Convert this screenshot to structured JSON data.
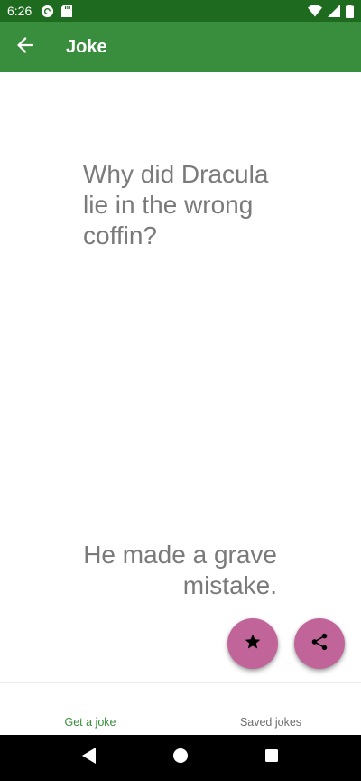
{
  "status_bar": {
    "time": "6:26",
    "left_icons": [
      "pocket-casts-icon",
      "sd-card-icon"
    ],
    "right_icons": [
      "wifi-icon",
      "signal-icon",
      "battery-icon"
    ]
  },
  "app_bar": {
    "title": "Joke",
    "back_icon": "arrow-back-icon"
  },
  "joke": {
    "setup": "Why did Dracula lie in the wrong coffin?",
    "punchline": "He made a grave mistake."
  },
  "fabs": [
    {
      "icon": "star-icon"
    },
    {
      "icon": "share-icon"
    }
  ],
  "tabs": [
    {
      "label": "Get a joke",
      "active": true
    },
    {
      "label": "Saved jokes",
      "active": false
    }
  ],
  "nav_bar": {
    "icons": [
      "back-triangle-icon",
      "home-circle-icon",
      "recents-square-icon"
    ]
  },
  "colors": {
    "status_bar": "#1e6b1f",
    "app_bar": "#388e3c",
    "fab": "#c0649a",
    "active_tab": "#388e3c",
    "joke_text": "#7a7a7a"
  }
}
